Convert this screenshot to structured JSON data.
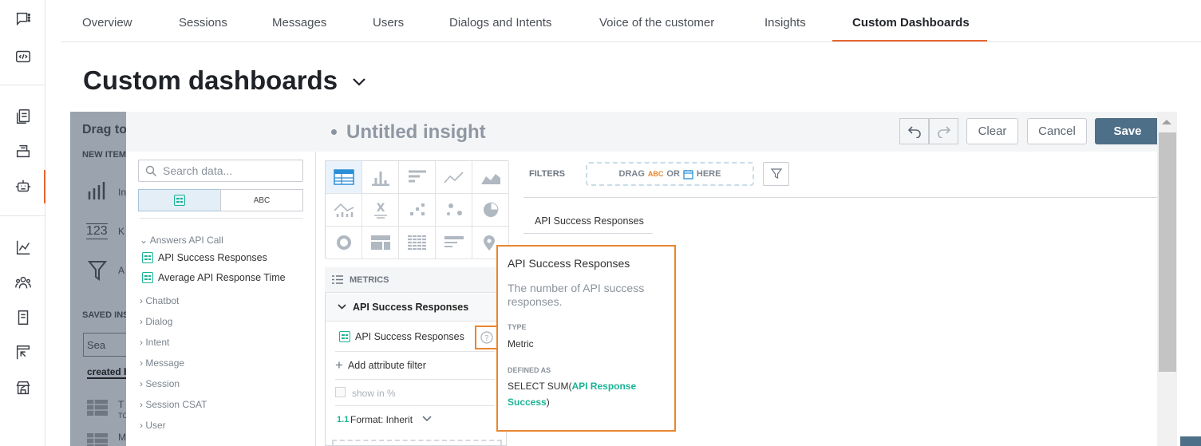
{
  "tabs": [
    "Overview",
    "Sessions",
    "Messages",
    "Users",
    "Dialogs and Intents",
    "Voice of the customer",
    "Insights",
    "Custom Dashboards"
  ],
  "page_title": "Custom dashboards",
  "overlay": {
    "drag_title": "Drag to",
    "new_items_label": "NEW ITEM",
    "item_insight_prefix": "In",
    "item_kpi_prefix": "K",
    "item_attr_prefix": "A",
    "kpi_icon_text": "123",
    "saved_label": "SAVED INS",
    "search_prefix": "Sea",
    "sort_label": "created b",
    "list_item_1": "T",
    "list_item_1_sub": "TC",
    "list_item_2": "M"
  },
  "editor": {
    "title": "Untitled insight",
    "clear_label": "Clear",
    "cancel_label": "Cancel",
    "save_label": "Save"
  },
  "data_panel": {
    "search_placeholder": "Search data...",
    "toggle_abc": "ABC",
    "groups": [
      "Answers API Call",
      "Chatbot",
      "Dialog",
      "Intent",
      "Message",
      "Session",
      "Session CSAT",
      "User"
    ],
    "metrics": [
      "API Success Responses",
      "Average API Response Time"
    ]
  },
  "buckets": {
    "metrics_label": "METRICS",
    "metric_name": "API Success Responses",
    "metric_item": "API Success Responses",
    "add_filter": "Add attribute filter",
    "show_in_percent": "show in %",
    "format_prefix": "1.1",
    "format_label": "Format: Inherit"
  },
  "filters": {
    "label": "FILTERS",
    "drop_drag": "DRAG",
    "drop_abc": "ABC",
    "drop_or": "OR",
    "drop_here": "HERE"
  },
  "canvas": {
    "column_header": "API Success Responses"
  },
  "tooltip": {
    "title": "API Success Responses",
    "description": "The number of API success responses.",
    "type_label": "TYPE",
    "type_value": "Metric",
    "defined_label": "DEFINED AS",
    "defined_prefix": "SELECT SUM(",
    "defined_attr": "API Response Success",
    "defined_suffix": ")"
  },
  "colors": {
    "accent": "#e8662e",
    "metric_green": "#1ab394",
    "save_blue": "#4e6f88"
  }
}
